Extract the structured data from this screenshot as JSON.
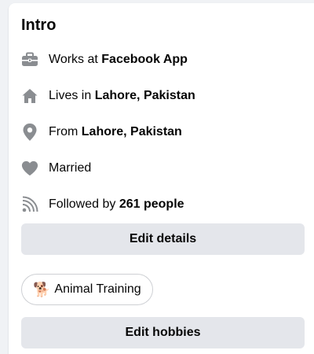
{
  "intro": {
    "title": "Intro",
    "items": [
      {
        "icon": "briefcase-icon",
        "prefix": "Works at ",
        "value": "Facebook App"
      },
      {
        "icon": "home-icon",
        "prefix": "Lives in ",
        "value": "Lahore, Pakistan"
      },
      {
        "icon": "location-pin-icon",
        "prefix": "From ",
        "value": "Lahore, Pakistan"
      },
      {
        "icon": "heart-icon",
        "prefix": "Married",
        "value": ""
      },
      {
        "icon": "rss-feed-icon",
        "prefix": "Followed by ",
        "value": "261 people"
      }
    ],
    "edit_details_label": "Edit details",
    "hobby": {
      "emoji": "🐕",
      "label": "Animal Training"
    },
    "edit_hobbies_label": "Edit hobbies"
  },
  "colors": {
    "icon": "#8a8d91",
    "button_bg": "#e4e6eb",
    "text": "#050505"
  }
}
